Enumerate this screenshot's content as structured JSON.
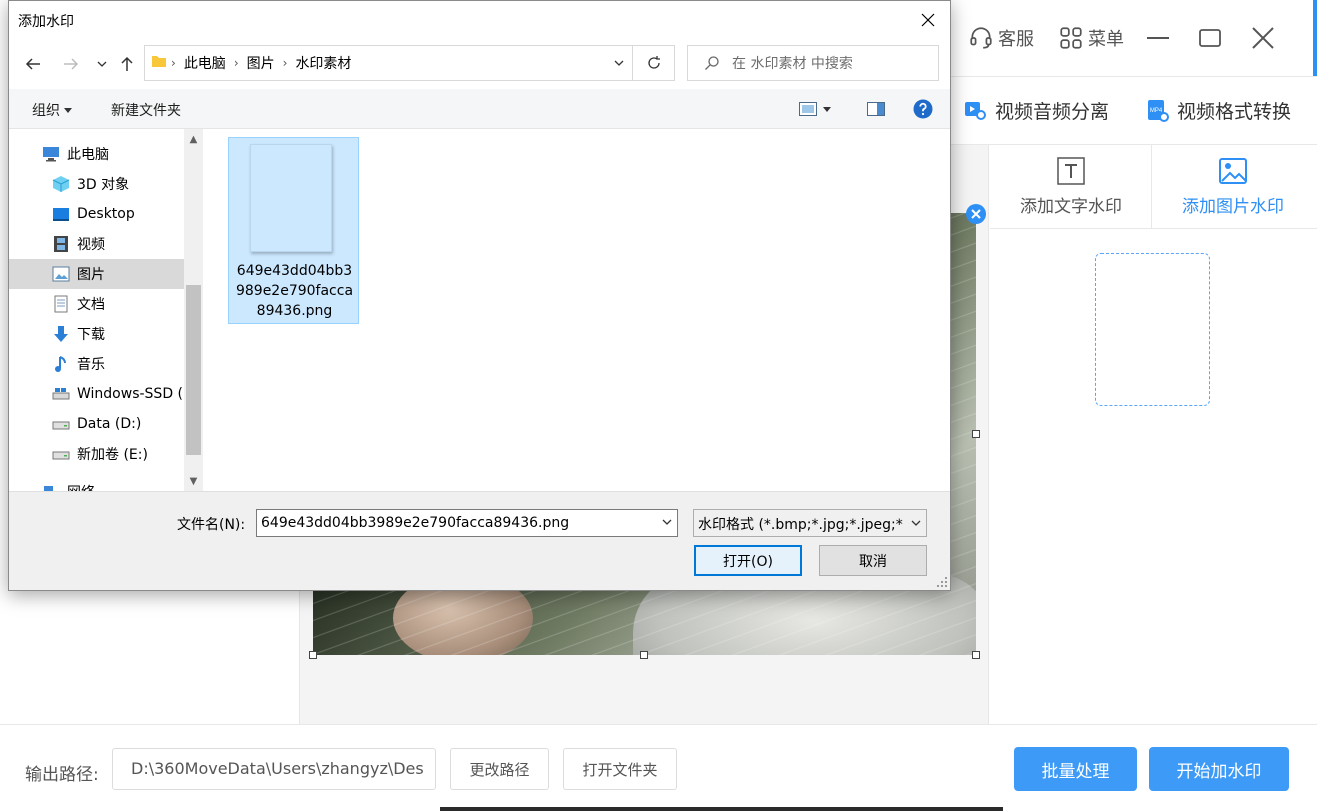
{
  "app": {
    "service_label": "客服",
    "menu_label": "菜单",
    "features": [
      {
        "label": "视频音频分离",
        "icon": "video-audio-icon"
      },
      {
        "label": "视频格式转换",
        "icon": "mp4-icon"
      }
    ],
    "mp4_badge": "MP4",
    "side_tabs": [
      {
        "label": "添加文字水印",
        "icon": "text-t-icon",
        "active": false
      },
      {
        "label": "添加图片水印",
        "icon": "image-icon",
        "active": true
      }
    ],
    "output_label": "输出路径:",
    "output_path": "D:\\360MoveData\\Users\\zhangyz\\Des",
    "change_path_label": "更改路径",
    "open_folder_label": "打开文件夹",
    "batch_label": "批量处理",
    "start_label": "开始加水印",
    "accent_color": "#2e8ff5"
  },
  "dialog": {
    "title": "添加水印",
    "breadcrumb": [
      "此电脑",
      "图片",
      "水印素材"
    ],
    "search_placeholder": "在 水印素材 中搜索",
    "toolbar": {
      "organize_label": "组织",
      "new_folder_label": "新建文件夹"
    },
    "tree": [
      {
        "label": "此电脑",
        "icon": "computer-icon",
        "indent": 1,
        "selected": false
      },
      {
        "label": "3D 对象",
        "icon": "cube-3d-icon",
        "indent": 2,
        "selected": false
      },
      {
        "label": "Desktop",
        "icon": "desktop-icon",
        "indent": 2,
        "selected": false
      },
      {
        "label": "视频",
        "icon": "film-icon",
        "indent": 2,
        "selected": false
      },
      {
        "label": "图片",
        "icon": "pictures-icon",
        "indent": 2,
        "selected": true
      },
      {
        "label": "文档",
        "icon": "document-icon",
        "indent": 2,
        "selected": false
      },
      {
        "label": "下载",
        "icon": "download-icon",
        "indent": 2,
        "selected": false
      },
      {
        "label": "音乐",
        "icon": "music-icon",
        "indent": 2,
        "selected": false
      },
      {
        "label": "Windows-SSD (",
        "icon": "drive-icon",
        "indent": 2,
        "selected": false
      },
      {
        "label": "Data (D:)",
        "icon": "drive-icon",
        "indent": 2,
        "selected": false
      },
      {
        "label": "新加卷 (E:)",
        "icon": "drive-icon",
        "indent": 2,
        "selected": false
      },
      {
        "label": "网络",
        "icon": "network-icon",
        "indent": 1,
        "selected": false
      }
    ],
    "file": {
      "name": "649e43dd04bb3989e2e790facca89436.png"
    },
    "filename_label": "文件名(N):",
    "filename_value": "649e43dd04bb3989e2e790facca89436.png",
    "filetype_value": "水印格式 (*.bmp;*.jpg;*.jpeg;*",
    "open_label": "打开(O)",
    "cancel_label": "取消"
  }
}
